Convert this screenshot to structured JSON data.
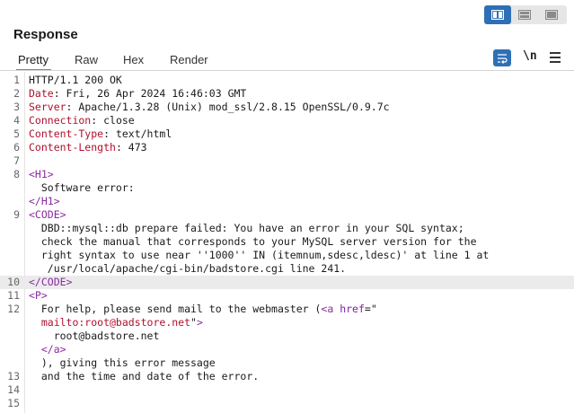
{
  "colors": {
    "accent_blue": "#2f6fb6",
    "tab_underline": "#e8632b",
    "header_key": "#b0102c",
    "tag": "#8a2ba0"
  },
  "layout_toggle": {
    "icons": [
      "split-horizontal-icon",
      "split-vertical-icon",
      "single-pane-icon"
    ],
    "active": "split-horizontal-icon"
  },
  "panel": {
    "title": "Response"
  },
  "tabs": [
    {
      "label": "Pretty",
      "active": true
    },
    {
      "label": "Raw",
      "active": false
    },
    {
      "label": "Hex",
      "active": false
    },
    {
      "label": "Render",
      "active": false
    }
  ],
  "toolbar": {
    "newline_label": "\\n",
    "wrap_icon": "word-wrap-icon",
    "menu_icon": "menu-icon"
  },
  "lines": [
    {
      "n": "1",
      "a": "HTTP/1.1 200 OK"
    },
    {
      "n": "2",
      "k": "Date",
      "v": ": Fri, 26 Apr 2024 16:46:03 GMT"
    },
    {
      "n": "3",
      "k": "Server",
      "v": ": Apache/1.3.28 (Unix) mod_ssl/2.8.15 OpenSSL/0.9.7c"
    },
    {
      "n": "4",
      "k": "Connection",
      "v": ": close"
    },
    {
      "n": "5",
      "k": "Content-Type",
      "v": ": text/html"
    },
    {
      "n": "6",
      "k": "Content-Length",
      "v": ": 473"
    },
    {
      "n": "7"
    },
    {
      "n": "8",
      "t": "<H1>"
    },
    {
      "n": "",
      "a": "  Software error:"
    },
    {
      "n": "",
      "t": "</H1>"
    },
    {
      "n": "9",
      "t": "<CODE>"
    },
    {
      "n": "",
      "a": "  DBD::mysql::db prepare failed: You have an error in your SQL syntax;"
    },
    {
      "n": "",
      "a": "  check the manual that corresponds to your MySQL server version for the"
    },
    {
      "n": "",
      "a": "  right syntax to use near ''1000'' IN (itemnum,sdesc,ldesc)' at line 1 at"
    },
    {
      "n": "",
      "a": "   /usr/local/apache/cgi-bin/badstore.cgi line 241."
    },
    {
      "n": "10",
      "t": "</CODE>",
      "hl": true
    },
    {
      "n": "11",
      "t": "<P>"
    },
    {
      "n": "12",
      "a": "  For help, please send mail to the webmaster (",
      "t2": "<a ",
      "at": "href",
      "eq": "=\""
    },
    {
      "n": "",
      "av": "  mailto:root@badstore.net",
      "q": "\"",
      "t2": ">"
    },
    {
      "n": "",
      "a": "    root@badstore.net"
    },
    {
      "n": "",
      "t": "  </a>"
    },
    {
      "n": "",
      "a": "  ), giving this error message"
    },
    {
      "n": "13",
      "a": "  and the time and date of the error."
    },
    {
      "n": "14"
    },
    {
      "n": "15"
    }
  ]
}
